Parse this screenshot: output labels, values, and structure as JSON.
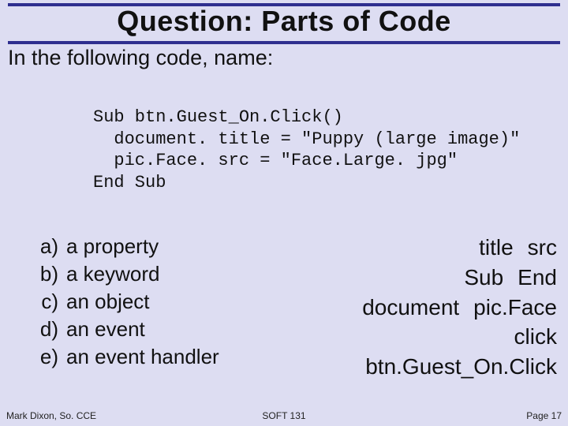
{
  "title": "Question: Parts of Code",
  "intro": "In the following code, name:",
  "code": "Sub btn.Guest_On.Click()\n  document. title = \"Puppy (large image)\"\n  pic.Face. src = \"Face.Large. jpg\"\nEnd Sub",
  "options": [
    {
      "letter": "a)",
      "text": "a property"
    },
    {
      "letter": "b)",
      "text": "a keyword"
    },
    {
      "letter": "c)",
      "text": "an object"
    },
    {
      "letter": "d)",
      "text": "an event"
    },
    {
      "letter": "e)",
      "text": "an event handler"
    }
  ],
  "answers": [
    {
      "left": "title",
      "right": "src"
    },
    {
      "left": "Sub",
      "right": "End"
    },
    {
      "left": "document",
      "right": "pic.Face"
    },
    {
      "left": "",
      "right": "click"
    },
    {
      "left": "",
      "right": "btn.Guest_On.Click"
    }
  ],
  "footer": {
    "left": "Mark Dixon, So. CCE",
    "center": "SOFT 131",
    "right": "Page 17"
  }
}
